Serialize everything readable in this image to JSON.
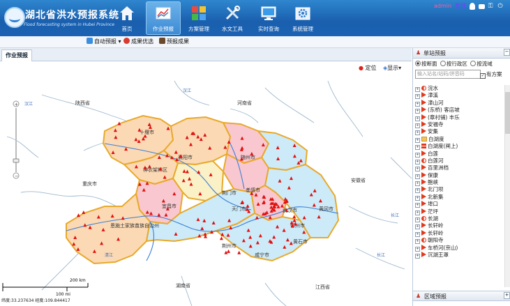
{
  "app": {
    "title": "湖北省洪水预报系统",
    "subtitle": "Flood forecasting system in Hubei Province"
  },
  "nav": [
    {
      "label": "首页",
      "icon": "home-icon",
      "active": false
    },
    {
      "label": "作业预报",
      "icon": "chart-icon",
      "active": true
    },
    {
      "label": "方案管理",
      "icon": "puzzle-icon",
      "active": false
    },
    {
      "label": "水文工具",
      "icon": "tools-icon",
      "active": false
    },
    {
      "label": "实时查询",
      "icon": "monitor-icon",
      "active": false
    },
    {
      "label": "系统管理",
      "icon": "settings-icon",
      "active": false
    }
  ],
  "user": {
    "name": "admin",
    "role": "管理"
  },
  "toolbar": {
    "auto_forecast": "自动预报",
    "result_select": "成果优选",
    "forecast_result": "预报成果"
  },
  "main_tab": "作业预报",
  "map_tools": {
    "locate": "定位",
    "display": "显示"
  },
  "map": {
    "labels": [
      "陕西省",
      "河南省",
      "安徽省",
      "重庆市",
      "湖南省",
      "江西省",
      "十堰市",
      "襄阳市",
      "神农架林区",
      "随州市",
      "孝感市",
      "荆门市",
      "宜昌市",
      "恩施土家族苗族自治州",
      "天门市",
      "武汉市",
      "黄冈市",
      "鄂州市",
      "黄石市",
      "荆州市",
      "咸宁市"
    ],
    "river_labels": [
      "汉江",
      "汉江",
      "长江",
      "清江",
      "长江"
    ],
    "scale_label": "200 km",
    "scale_sub": "100 mi",
    "coord": "纬度:33.237634  经度:109.844417"
  },
  "panel": {
    "title": "单站预报",
    "radios": [
      {
        "label": "按断面",
        "checked": true
      },
      {
        "label": "按行政区",
        "checked": false
      },
      {
        "label": "按流域",
        "checked": false
      }
    ],
    "search_placeholder": "输入站名/站码/拼音码",
    "has_plan_label": "有方案",
    "stations": [
      {
        "name": "浣水",
        "type": "half"
      },
      {
        "name": "漳溪",
        "type": "tri"
      },
      {
        "name": "漳山河",
        "type": "tri"
      },
      {
        "name": "(东桥) 客店坡",
        "type": "tri"
      },
      {
        "name": "(章村铺) 丰乐",
        "type": "tri"
      },
      {
        "name": "安福寺",
        "type": "tri"
      },
      {
        "name": "安集",
        "type": "tri"
      },
      {
        "name": "白湖度",
        "type": "folder"
      },
      {
        "name": "白湖度(闸上)",
        "type": "gate"
      },
      {
        "name": "白莲",
        "type": "tri"
      },
      {
        "name": "白莲河",
        "type": "half"
      },
      {
        "name": "百里洲档",
        "type": "tri"
      },
      {
        "name": "保康",
        "type": "tri"
      },
      {
        "name": "鲍峡",
        "type": "tri"
      },
      {
        "name": "北门坝",
        "type": "tri"
      },
      {
        "name": "北新集",
        "type": "tri"
      },
      {
        "name": "埠口",
        "type": "tri"
      },
      {
        "name": "茫坪",
        "type": "tri"
      },
      {
        "name": "长湖",
        "type": "half"
      },
      {
        "name": "长轩岭",
        "type": "tri"
      },
      {
        "name": "长轩岭",
        "type": "tri"
      },
      {
        "name": "朝阳寺",
        "type": "half"
      },
      {
        "name": "车桥河(京山)",
        "type": "tri"
      },
      {
        "name": "沉湖王罩",
        "type": "tri"
      }
    ],
    "bottom_title": "区域预报"
  },
  "colors": {
    "header": "#1b63b3",
    "region_orange": "#fbd9b4",
    "region_pink": "#f9c7cf",
    "region_blue": "#cdeaf8",
    "region_yellow": "#fbf1c6",
    "border": "#e8a92a",
    "station": "#e01010"
  }
}
